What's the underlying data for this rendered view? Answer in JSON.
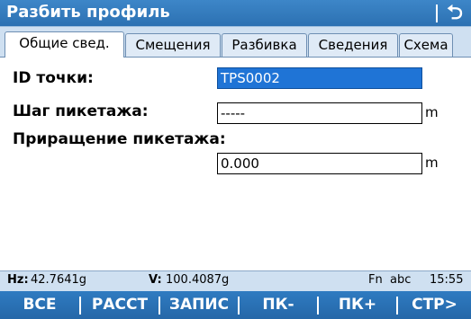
{
  "window": {
    "title": "Разбить профиль",
    "back_icon": "back-arrow-icon"
  },
  "tabs": [
    {
      "label": "Общие свед.",
      "active": true
    },
    {
      "label": "Смещения",
      "active": false
    },
    {
      "label": "Разбивка",
      "active": false
    },
    {
      "label": "Сведения",
      "active": false
    },
    {
      "label": "Схема",
      "active": false
    }
  ],
  "form": {
    "point_id": {
      "label": "ID точки:",
      "value": "TPS0002"
    },
    "chainage_step": {
      "label": "Шаг пикетажа:",
      "value": "-----",
      "unit": "m"
    },
    "chainage_increment": {
      "label": "Приращение пикетажа:",
      "value": "0.000",
      "unit": "m"
    }
  },
  "status": {
    "hz_label": "Hz:",
    "hz_value": "42.7641g",
    "v_label": "V:",
    "v_value": "100.4087g",
    "mode": "Fn  abc",
    "time": "15:55"
  },
  "fkeys": [
    "ВСЕ",
    "РАССТ",
    "ЗАПИС",
    "ПК-",
    "ПК+",
    "СТР>"
  ],
  "colors": {
    "title_bar": "#2c71b2",
    "tab_strip": "#cfe0f1",
    "selection": "#1f74d6",
    "function_bar": "#2567a8"
  }
}
